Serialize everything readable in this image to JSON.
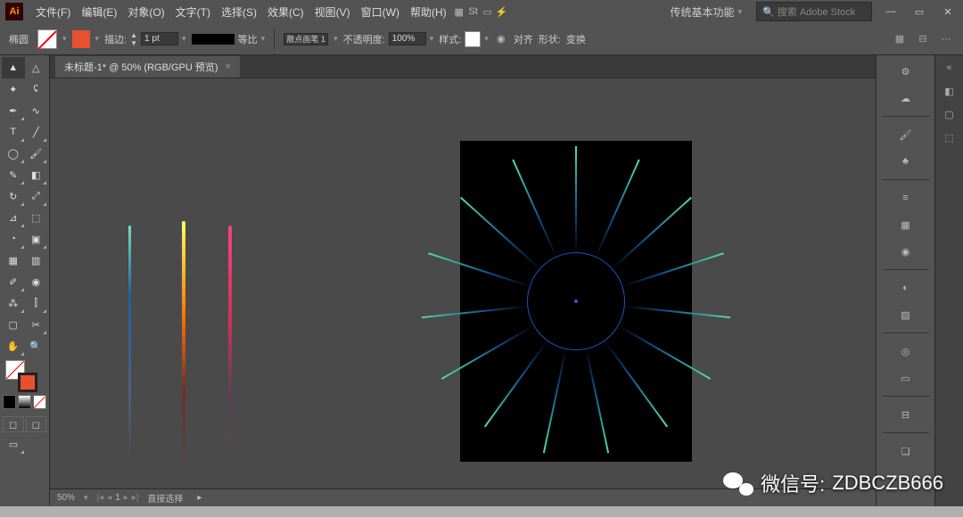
{
  "app": {
    "icon_text": "Ai"
  },
  "menu": [
    "文件(F)",
    "编辑(E)",
    "对象(O)",
    "文字(T)",
    "选择(S)",
    "效果(C)",
    "视图(V)",
    "窗口(W)",
    "帮助(H)"
  ],
  "workspace_label": "传统基本功能",
  "search_placeholder": "搜索 Adobe Stock",
  "ctrl": {
    "shape_label": "椭圆",
    "stroke_label": "描边:",
    "stroke_val": "1 pt",
    "ratio_label": "等比",
    "brush_label": "散点画笔 1",
    "opacity_label": "不透明度:",
    "opacity_val": "100%",
    "style_label": "样式:",
    "align_label": "对齐",
    "shape_btn": "形状:",
    "transform_label": "变换"
  },
  "doc_tab": {
    "title": "未标题-1* @ 50% (RGB/GPU 预览)",
    "close": "×"
  },
  "status": {
    "zoom": "50%",
    "page": "1",
    "tool": "直接选择"
  },
  "watermark": {
    "label": "微信号:",
    "id": "ZDBCZB666"
  },
  "rays": [
    0,
    24,
    48,
    72,
    96,
    120,
    144,
    168,
    192,
    216,
    240,
    264,
    288,
    312,
    336
  ]
}
